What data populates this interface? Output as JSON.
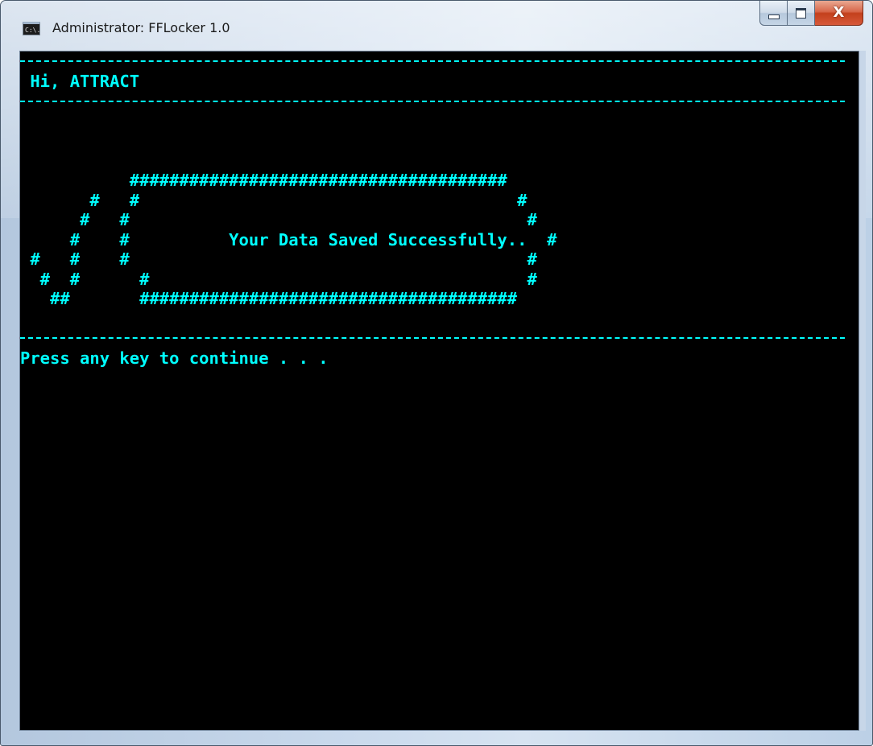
{
  "window": {
    "title": "Administrator:  FFLocker 1.0",
    "icon": "console-icon",
    "icon_text": "C:\\.",
    "buttons": {
      "minimize": "minimize-icon",
      "maximize": "maximize-icon",
      "close": "close-icon",
      "close_glyph": "X"
    }
  },
  "console": {
    "greeting": " Hi, ATTRACT",
    "art_lines": [
      "",
      "",
      "",
      "           ######################################",
      "       #   #                                      #",
      "      #   #                                        #",
      "     #    #          Your Data Saved Successfully..  #",
      " #   #    #                                        #",
      "  #  #      #                                      #",
      "   ##       ######################################",
      ""
    ],
    "prompt": "Press any key to continue . . ."
  },
  "colors": {
    "console_bg": "#000000",
    "console_text": "#00ffff"
  }
}
